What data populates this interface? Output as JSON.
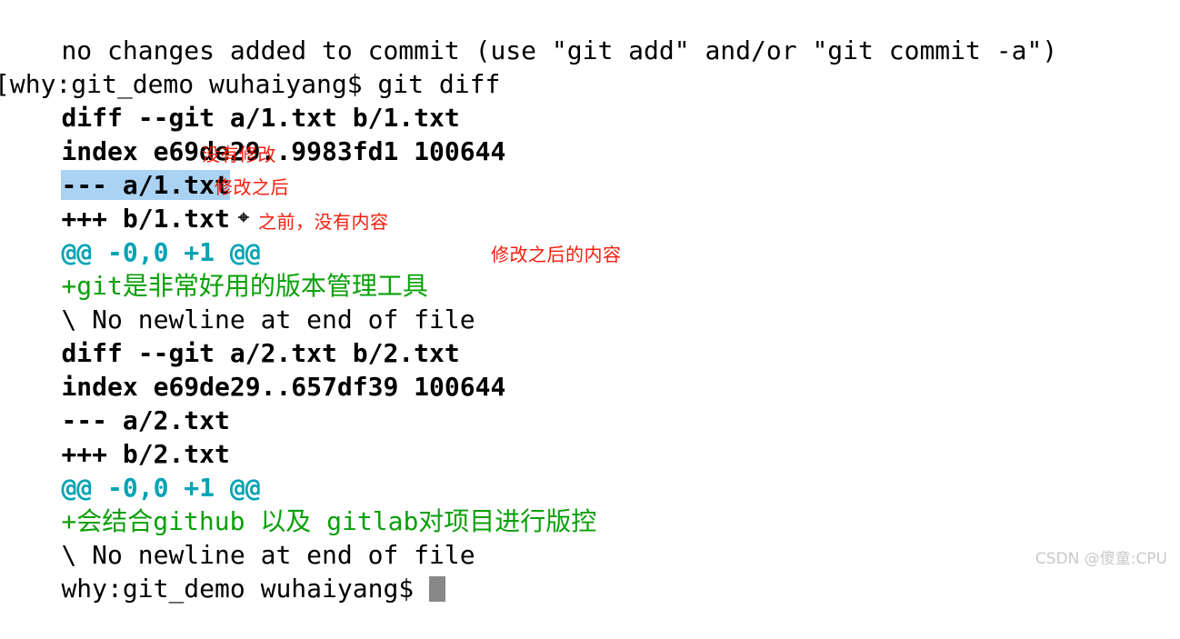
{
  "terminal": {
    "colors": {
      "background": "#ffffff",
      "foreground": "#000000",
      "added_green": "#09a009",
      "hunk_cyan": "#00a3b4",
      "selection_blue": "#a9d2f3",
      "annotation_red": "#f61d0d",
      "cursor_gray": "#888888"
    },
    "lines": [
      {
        "id": "l1",
        "text": "no changes added to commit (use \"git add\" and/or \"git commit -a\")"
      },
      {
        "id": "l2",
        "text": "[why:git_demo wuhaiyang$ git diff"
      },
      {
        "id": "l3",
        "text": "diff --git a/1.txt b/1.txt"
      },
      {
        "id": "l4",
        "text": "index e69de29..9983fd1 100644"
      },
      {
        "id": "l5",
        "text": "--- a/1.txt"
      },
      {
        "id": "l6",
        "text": "+++ b/1.txt"
      },
      {
        "id": "l7",
        "text": "@@ -0,0 +1 @@"
      },
      {
        "id": "l8",
        "text": "+git是非常好用的版本管理工具"
      },
      {
        "id": "l9",
        "text": "\\ No newline at end of file"
      },
      {
        "id": "l10",
        "text": "diff --git a/2.txt b/2.txt"
      },
      {
        "id": "l11",
        "text": "index e69de29..657df39 100644"
      },
      {
        "id": "l12",
        "text": "--- a/2.txt"
      },
      {
        "id": "l13",
        "text": "+++ b/2.txt"
      },
      {
        "id": "l14",
        "text": "@@ -0,0 +1 @@"
      },
      {
        "id": "l15",
        "text": "+会结合github 以及 gitlab对项目进行版控"
      },
      {
        "id": "l16",
        "text": "\\ No newline at end of file"
      },
      {
        "id": "l17",
        "text": "why:git_demo wuhaiyang$ "
      }
    ],
    "prompt": "why:git_demo wuhaiyang$",
    "command": "git diff"
  },
  "annotations": [
    {
      "id": "a1",
      "text": "没有修改"
    },
    {
      "id": "a2",
      "text": "修改之后"
    },
    {
      "id": "a3",
      "text": "之前，没有内容"
    },
    {
      "id": "a4",
      "text": "修改之后的内容"
    }
  ],
  "watermark": {
    "text": "CSDN @傻童:CPU"
  }
}
